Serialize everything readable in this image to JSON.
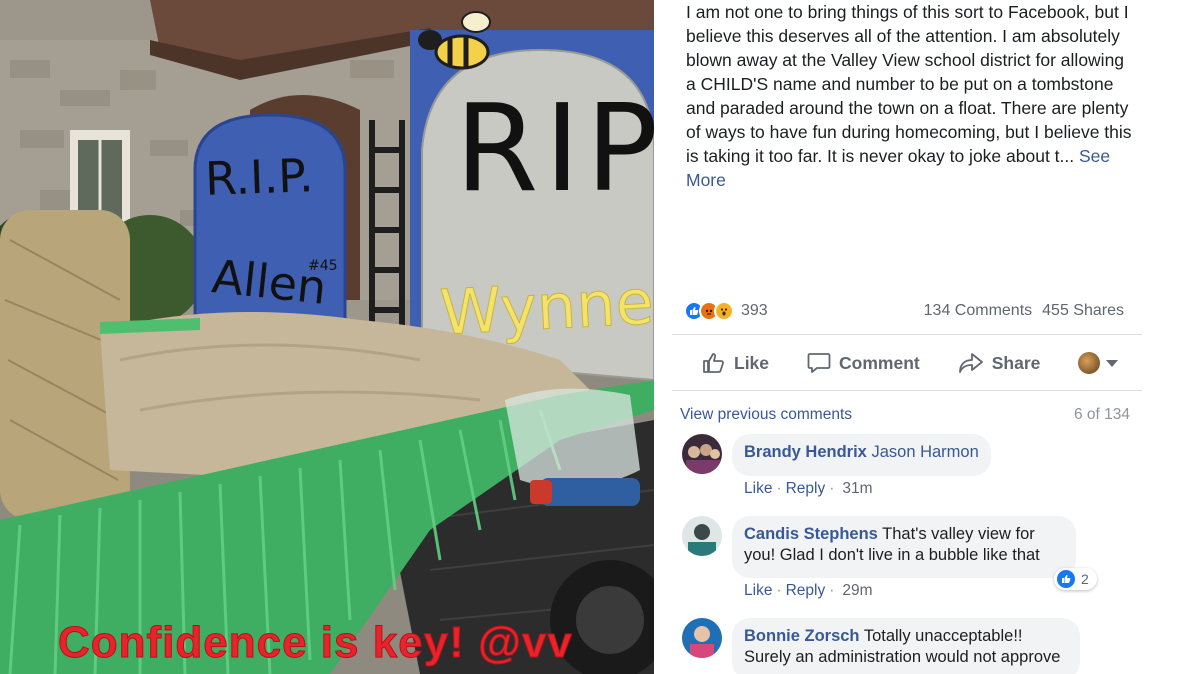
{
  "photo": {
    "caption": "Confidence is key! @vv",
    "left_sign": {
      "line1": "R.I.P.",
      "line2": "Allen",
      "number": "#45"
    },
    "right_sign": {
      "line1": "RIP",
      "line2": "Wynne!"
    }
  },
  "post": {
    "body": "I am not one to bring things of this sort to Facebook, but I believe this deserves all of the attention. I am absolutely blown away at the Valley View school district for allowing a CHILD'S name and number to be put on a tombstone and paraded around the town on a float. There are plenty of ways to have fun during homecoming, but I believe this is taking it too far. It is never okay to joke about t...",
    "see_more": "See More"
  },
  "stats": {
    "reaction_count": "393",
    "reaction_icons": [
      "like-icon",
      "angry-icon",
      "wow-icon"
    ],
    "comments": "134 Comments",
    "shares": "455 Shares"
  },
  "actions": {
    "like": "Like",
    "comment": "Comment",
    "share": "Share"
  },
  "comments_header": {
    "view_previous": "View previous comments",
    "count": "6 of 134"
  },
  "comments": [
    {
      "author": "Brandy Hendrix",
      "text": "Jason Harmon",
      "text_is_tag": true,
      "like": "Like",
      "reply": "Reply",
      "time": "31m"
    },
    {
      "author": "Candis Stephens",
      "text_line1": "That's valley view for",
      "text_line2": "you! Glad I don't live in a bubble like that",
      "like": "Like",
      "reply": "Reply",
      "time": "29m",
      "reactions": "2"
    },
    {
      "author": "Bonnie Zorsch",
      "text_line1": "Totally unacceptable!!",
      "text_line2": "Surely an administration would not approve"
    }
  ],
  "colors": {
    "link": "#385898",
    "bubble": "#f2f3f5",
    "secondary_text": "#606770",
    "caption_red": "#e8232a",
    "sign_blue": "#3f5fb3"
  }
}
